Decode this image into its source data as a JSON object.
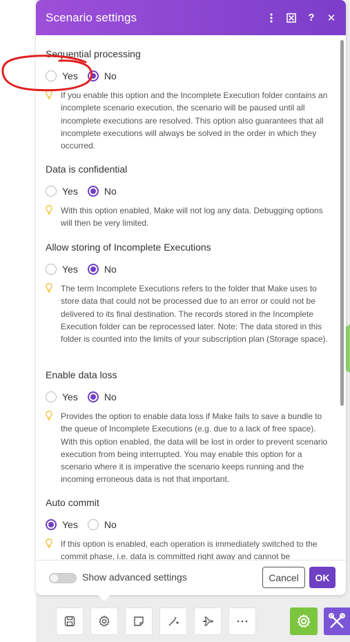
{
  "dialog": {
    "title": "Scenario settings",
    "header_icons": [
      "more-vertical-icon",
      "expand-icon",
      "help-icon",
      "close-icon"
    ]
  },
  "sections": [
    {
      "title": "Sequential processing",
      "yes_label": "Yes",
      "no_label": "No",
      "selected": "No",
      "help": "If you enable this option and the Incomplete Execution folder contains an incomplete scenario execution, the scenario will be paused until all incomplete executions are resolved. This option also guarantees that all incomplete executions will always be solved in the order in which they occurred."
    },
    {
      "title": "Data is confidential",
      "yes_label": "Yes",
      "no_label": "No",
      "selected": "No",
      "help": "With this option enabled, Make will not log any data. Debugging options will then be very limited."
    },
    {
      "title": "Allow storing of Incomplete Executions",
      "yes_label": "Yes",
      "no_label": "No",
      "selected": "No",
      "help": "The term Incomplete Executions refers to the folder that Make uses to store data that could not be processed due to an error or could not be delivered to its final destination. The records stored in the Incomplete Execution folder can be reprocessed later. Note: The data stored in this folder is counted into the limits of your subscription plan (Storage space)."
    },
    {
      "title": "Enable data loss",
      "yes_label": "Yes",
      "no_label": "No",
      "selected": "No",
      "help": "Provides the option to enable data loss if Make fails to save a bundle to the queue of Incomplete Executions (e.g. due to a lack of free space). With this option enabled, the data will be lost in order to prevent scenario execution from being interrupted. You may enable this option for a scenario where it is imperative the scenario keeps running and the incoming erroneous data is not that important."
    },
    {
      "title": "Auto commit",
      "yes_label": "Yes",
      "no_label": "No",
      "selected": "Yes",
      "help": "If this option is enabled, each operation is immediately switched to the commit phase, i.e. data is committed right away and cannot be"
    }
  ],
  "footer": {
    "toggle_label": "Show advanced settings",
    "toggle_on": false,
    "cancel_label": "Cancel",
    "ok_label": "OK"
  },
  "toolbar": {
    "buttons": [
      "save-icon",
      "settings-gear-icon",
      "notes-icon",
      "magic-wand-icon",
      "airplane-icon",
      "more-horizontal-icon"
    ],
    "accent_green": "#7cc53f",
    "accent_purple": "#7a55d6"
  },
  "colors": {
    "header_start": "#9d4fd9",
    "header_end": "#7b3ec9",
    "radio_selected": "#6f3fc4",
    "hint_bulb": "#f2c02e",
    "annotation": "#e0201f"
  }
}
